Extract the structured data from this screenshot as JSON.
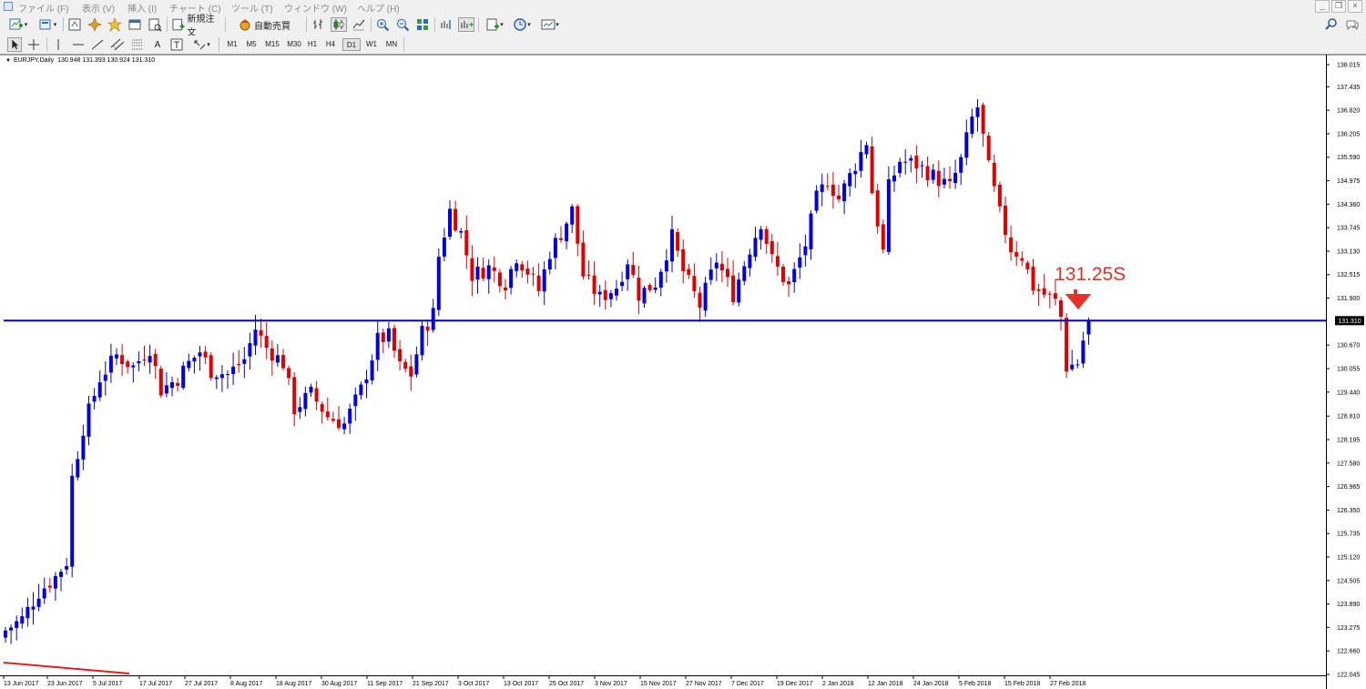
{
  "menu": {
    "items": [
      "ファイル (F)",
      "表示 (V)",
      "挿入 (I)",
      "チャート (C)",
      "ツール (T)",
      "ウィンドウ (W)",
      "ヘルプ (H)"
    ]
  },
  "toolbar": {
    "new_order_label": "新規注文",
    "auto_trade_label": "自動売買",
    "timeframes": [
      "M1",
      "M5",
      "M15",
      "M30",
      "H1",
      "H4",
      "D1",
      "W1",
      "MN"
    ],
    "active_timeframe": "D1"
  },
  "chart": {
    "title": "EURJPY,Daily",
    "ohlc": "130.948 131.393 130.924 131.310",
    "current_price_label": "131.310",
    "annotation": "131.25S",
    "colors": {
      "bull": "#0000e6",
      "bear": "#e00000",
      "hline": "#0000c8",
      "annotation": "#e8302a"
    }
  },
  "chart_data": {
    "type": "candlestick",
    "symbol": "EURJPY",
    "timeframe": "Daily",
    "ylim": [
      122.045,
      138.015
    ],
    "y_ticks": [
      "138.015",
      "137.435",
      "136.820",
      "136.205",
      "135.590",
      "134.975",
      "134.360",
      "133.745",
      "133.130",
      "132.515",
      "131.900",
      "131.310",
      "130.670",
      "130.055",
      "129.440",
      "128.810",
      "128.195",
      "127.580",
      "126.965",
      "126.350",
      "125.735",
      "125.120",
      "124.505",
      "123.890",
      "123.275",
      "122.660",
      "122.045"
    ],
    "x_ticks": [
      "13 Jun 2017",
      "23 Jun 2017",
      "5 Jul 2017",
      "17 Jul 2017",
      "27 Jul 2017",
      "8 Aug 2017",
      "18 Aug 2017",
      "30 Aug 2017",
      "11 Sep 2017",
      "21 Sep 2017",
      "3 Oct 2017",
      "13 Oct 2017",
      "25 Oct 2017",
      "3 Nov 2017",
      "15 Nov 2017",
      "27 Nov 2017",
      "7 Dec 2017",
      "19 Dec 2017",
      "2 Jan 2018",
      "12 Jan 2018",
      "24 Jan 2018",
      "5 Feb 2018",
      "15 Feb 2018",
      "27 Feb 2018"
    ],
    "horizontal_line": 131.31,
    "annotation": "131.25S",
    "close_path": [
      [
        0,
        123.2
      ],
      [
        3,
        123.5
      ],
      [
        6,
        124.2
      ],
      [
        9,
        124.6
      ],
      [
        11,
        125.0
      ],
      [
        12,
        127.2
      ],
      [
        14,
        128.5
      ],
      [
        17,
        129.8
      ],
      [
        20,
        130.4
      ],
      [
        23,
        130.1
      ],
      [
        26,
        130.6
      ],
      [
        28,
        129.5
      ],
      [
        31,
        129.8
      ],
      [
        33,
        130.2
      ],
      [
        35,
        130.5
      ],
      [
        37,
        130.0
      ],
      [
        40,
        129.9
      ],
      [
        43,
        130.3
      ],
      [
        45,
        131.1
      ],
      [
        47,
        130.6
      ],
      [
        50,
        130.2
      ],
      [
        52,
        129.0
      ],
      [
        55,
        129.4
      ],
      [
        58,
        128.8
      ],
      [
        61,
        128.6
      ],
      [
        64,
        129.5
      ],
      [
        67,
        130.8
      ],
      [
        69,
        130.9
      ],
      [
        71,
        130.1
      ],
      [
        73,
        129.9
      ],
      [
        75,
        131.0
      ],
      [
        77,
        131.5
      ],
      [
        78,
        133.0
      ],
      [
        80,
        134.2
      ],
      [
        82,
        133.6
      ],
      [
        84,
        132.5
      ],
      [
        87,
        132.7
      ],
      [
        90,
        132.3
      ],
      [
        92,
        133.0
      ],
      [
        94,
        132.6
      ],
      [
        96,
        132.1
      ],
      [
        98,
        133.1
      ],
      [
        100,
        133.6
      ],
      [
        102,
        134.2
      ],
      [
        104,
        132.5
      ],
      [
        107,
        131.9
      ],
      [
        110,
        132.2
      ],
      [
        112,
        132.9
      ],
      [
        114,
        132.0
      ],
      [
        117,
        132.3
      ],
      [
        120,
        133.5
      ],
      [
        122,
        132.6
      ],
      [
        125,
        131.7
      ],
      [
        128,
        132.9
      ],
      [
        131,
        132.0
      ],
      [
        134,
        133.2
      ],
      [
        136,
        133.9
      ],
      [
        138,
        132.9
      ],
      [
        141,
        132.2
      ],
      [
        144,
        133.3
      ],
      [
        146,
        134.5
      ],
      [
        148,
        135.0
      ],
      [
        150,
        134.5
      ],
      [
        153,
        135.4
      ],
      [
        155,
        136.0
      ],
      [
        156,
        134.7
      ],
      [
        158,
        133.1
      ],
      [
        159,
        134.8
      ],
      [
        161,
        135.5
      ],
      [
        164,
        135.4
      ],
      [
        167,
        135.1
      ],
      [
        170,
        134.8
      ],
      [
        172,
        135.5
      ],
      [
        174,
        136.6
      ],
      [
        175,
        136.9
      ],
      [
        177,
        135.3
      ],
      [
        179,
        134.1
      ],
      [
        181,
        133.2
      ],
      [
        183,
        133.0
      ],
      [
        185,
        132.2
      ],
      [
        187,
        132.0
      ],
      [
        189,
        131.8
      ],
      [
        190,
        131.4
      ],
      [
        191,
        130.1
      ],
      [
        193,
        130.2
      ],
      [
        194,
        130.8
      ],
      [
        195,
        131.31
      ]
    ]
  }
}
